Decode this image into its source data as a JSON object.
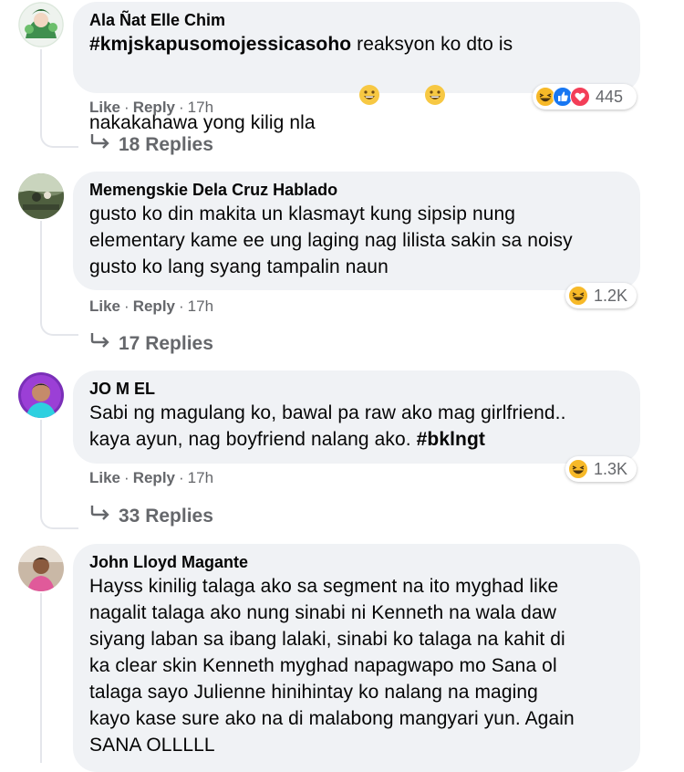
{
  "comments": [
    {
      "author": "Ala Ñat Elle Chim",
      "hashtag": "#kmjskapusomojessicasoho",
      "text_after_hashtag": " reaksyon ko dto is",
      "line2": "nakakahawa yong kilig nla",
      "like": "Like",
      "reply": "Reply",
      "time": "17h",
      "replies": "18 Replies",
      "reaction_count": "445",
      "reaction_icons": [
        "haha-icon",
        "like-icon",
        "love-icon"
      ]
    },
    {
      "author": "Memengskie Dela Cruz Hablado",
      "lines": [
        "gusto ko din makita un klasmayt kung sipsip nung",
        "elementary kame ee ung laging nag lilista sakin sa noisy",
        "gusto ko lang syang tampalin naun"
      ],
      "like": "Like",
      "reply": "Reply",
      "time": "17h",
      "replies": "17 Replies",
      "reaction_count": "1.2K",
      "reaction_icons": [
        "haha-icon"
      ]
    },
    {
      "author": "JO M EL",
      "line1": "Sabi ng magulang ko, bawal pa raw ako mag girlfriend..",
      "line2_prefix": "kaya ayun, nag boyfriend nalang ako. ",
      "hashtag": "#bklngt",
      "like": "Like",
      "reply": "Reply",
      "time": "17h",
      "replies": "33 Replies",
      "reaction_count": "1.3K",
      "reaction_icons": [
        "haha-icon"
      ]
    },
    {
      "author": "John Lloyd Magante",
      "lines": [
        "Hayss kinilig talaga ako sa segment na ito myghad like",
        "nagalit talaga ako nung sinabi ni Kenneth na wala daw",
        "siyang laban sa ibang lalaki, sinabi ko talaga na kahit di",
        "ka clear skin Kenneth myghad napagwapo mo Sana ol",
        "talaga sayo Julienne hinihintay ko nalang na maging",
        "kayo kase sure ako na di malabong mangyari yun. Again",
        "SANA OLLLLL"
      ]
    }
  ],
  "colors": {
    "bubble": "#f0f2f5",
    "meta_text": "#65676b",
    "like_blue": "#1877f2",
    "love_red": "#f33e58",
    "haha_yellow": "#f7b928"
  }
}
